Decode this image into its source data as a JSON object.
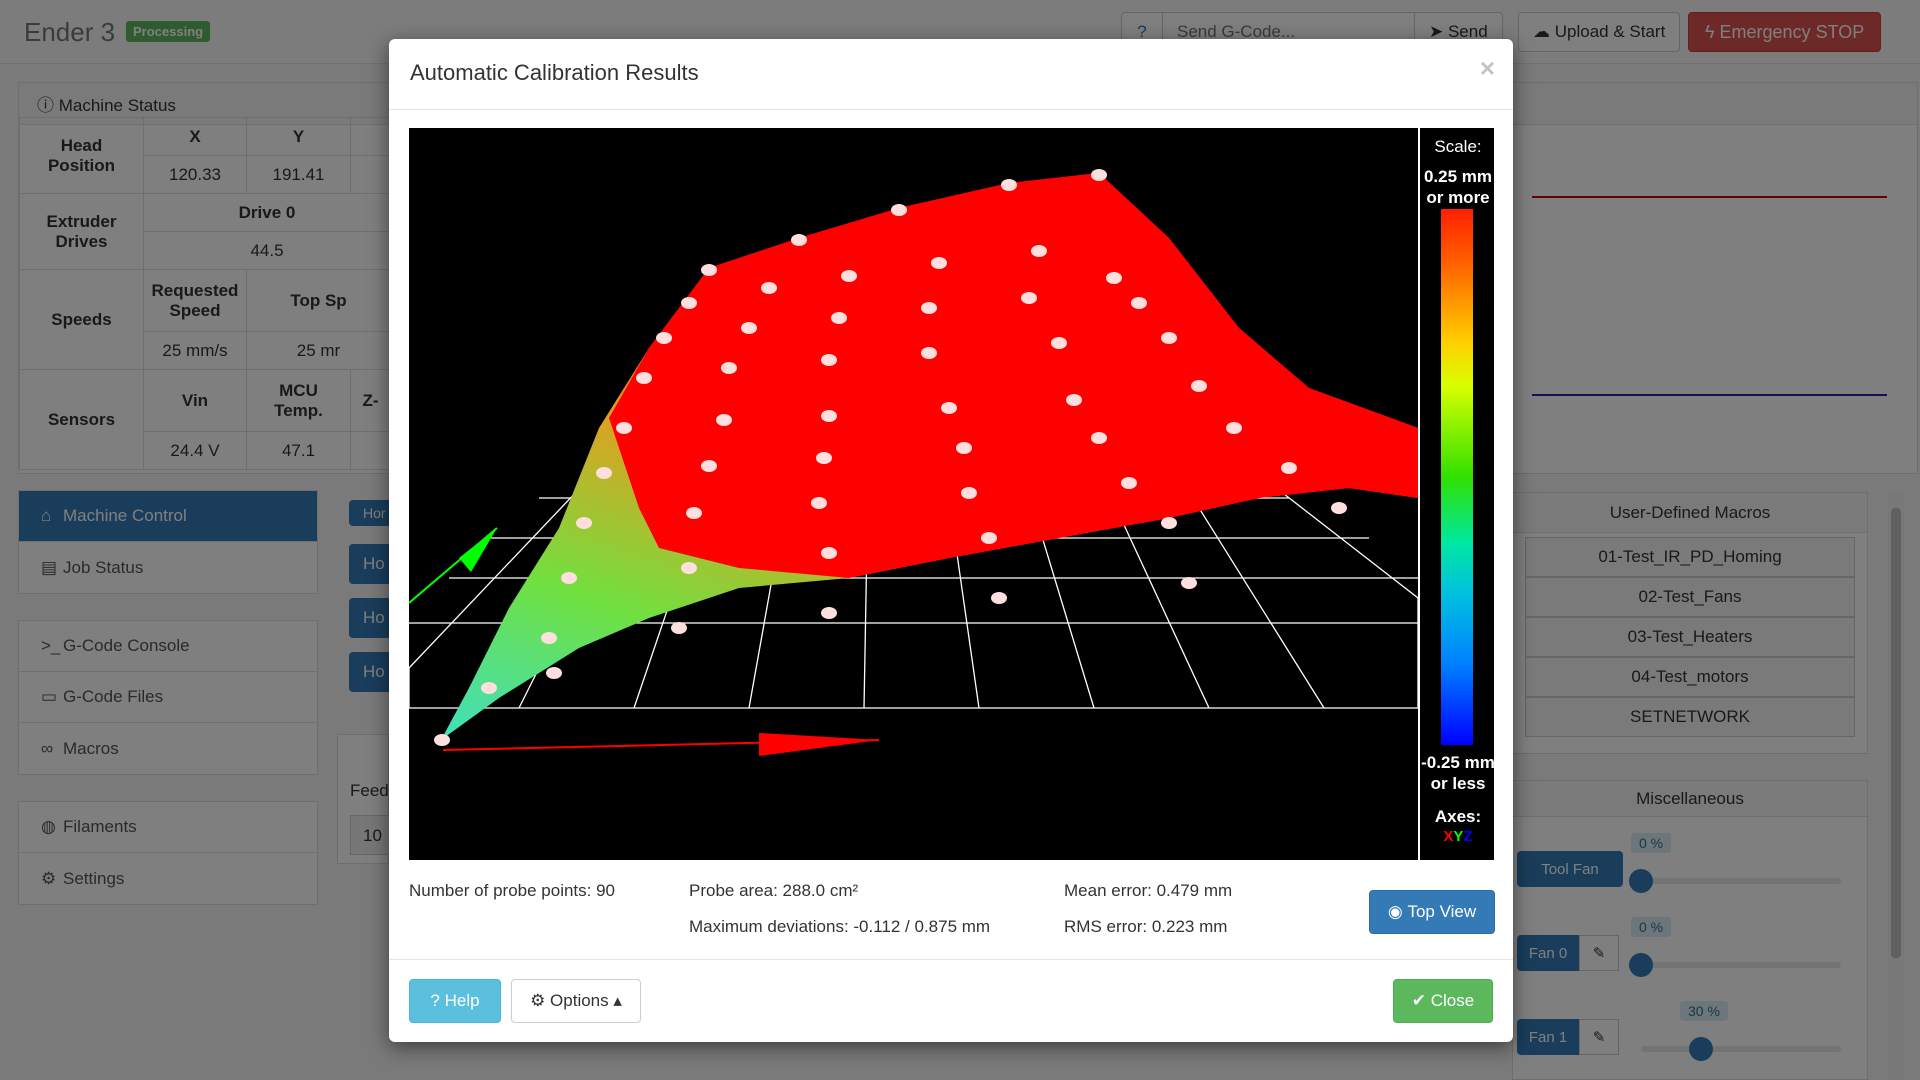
{
  "navbar": {
    "brand": "Ender 3",
    "status_badge": "Processing",
    "help_label": "?",
    "gcode_placeholder": "Send G-Code...",
    "send_label": "Send",
    "upload_label": "Upload & Start",
    "estop_label": "Emergency STOP"
  },
  "machine_status": {
    "title": "Machine Status",
    "head_position": {
      "label": "Head Position",
      "x_label": "X",
      "y_label": "Y",
      "x": "120.33",
      "y": "191.41"
    },
    "extruder": {
      "label": "Extruder Drives",
      "drive_label": "Drive 0",
      "drive_value": "44.5"
    },
    "speeds": {
      "label": "Speeds",
      "requested_label": "Requested Speed",
      "top_label": "Top Sp",
      "requested": "25 mm/s",
      "top": "25 mr"
    },
    "sensors": {
      "label": "Sensors",
      "vin_label": "Vin",
      "mcu_label": "MCU Temp.",
      "z_label": "Z-",
      "vin": "24.4 V",
      "mcu": "47.1"
    }
  },
  "left_nav": {
    "group1": [
      "Machine Control",
      "Job Status"
    ],
    "group2": [
      "G-Code Console",
      "G-Code Files",
      "Macros"
    ],
    "group3": [
      "Filaments",
      "Settings"
    ]
  },
  "middle": {
    "home_short": "Hor",
    "home_btn": "Ho",
    "feed_label": "Feed",
    "feed_value": "10"
  },
  "macros": {
    "title": "User-Defined Macros",
    "items": [
      "01-Test_IR_PD_Homing",
      "02-Test_Fans",
      "03-Test_Heaters",
      "04-Test_motors",
      "SETNETWORK"
    ]
  },
  "misc": {
    "title": "Miscellaneous",
    "fans": [
      {
        "label": "Tool Fan",
        "percent_label": "0 %",
        "value": 0
      },
      {
        "label": "Fan 0",
        "percent_label": "0 %",
        "value": 0
      },
      {
        "label": "Fan 1",
        "percent_label": "30 %",
        "value": 30
      }
    ]
  },
  "modal": {
    "title": "Automatic Calibration Results",
    "close_x": "×",
    "scale": {
      "title": "Scale:",
      "max_label": "0.25 mm or more",
      "min_label": "-0.25 mm or less",
      "axes_label": "Axes:",
      "x": "X",
      "y": "Y",
      "z": "Z"
    },
    "stats": {
      "probe_points": "Number of probe points: 90",
      "probe_area": "Probe area: 288.0 cm²",
      "max_dev": "Maximum deviations: -0.112 / 0.875 mm",
      "mean_error": "Mean error: 0.479 mm",
      "rms_error": "RMS error: 0.223 mm"
    },
    "top_view_label": "Top View",
    "help_label": "Help",
    "options_label": "Options",
    "close_label": "Close"
  },
  "colors": {
    "primary": "#337ab7",
    "success": "#5cb85c",
    "danger": "#d9534f",
    "info": "#5bc0de",
    "mesh": "#ff0000"
  }
}
